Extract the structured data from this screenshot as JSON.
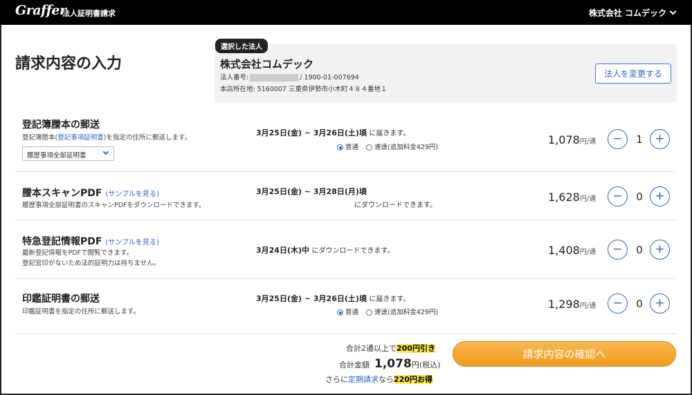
{
  "header": {
    "logo": "Graffer",
    "service": "法人証明書請求",
    "account": "株式会社 コムデック"
  },
  "page_title": "請求内容の入力",
  "selected_corp": {
    "tag": "選択した法人",
    "name": "株式会社コムデック",
    "number_label": "法人番号:",
    "number_suffix": "/ 1900-01-007694",
    "address": "本店所在地: 5160007 三重県伊勢市小木町４８４番地１",
    "change_button": "法人を変更する"
  },
  "items": [
    {
      "title": "登記簿謄本の郵送",
      "desc_prefix": "登記簿謄本(",
      "desc_link": "登記事項証明書",
      "desc_suffix": ")を指定の住所に郵送します。",
      "select_value": "履歴事項全部証明書",
      "delivery_bold": "3月25日(金) ~ 3月26日(土)頃",
      "delivery_rest": "に届きます。",
      "radio_normal": "普通",
      "radio_express": "速達(追加料金429円)",
      "price": "1,078",
      "unit": "円/通",
      "qty": "1"
    },
    {
      "title": "謄本スキャンPDF",
      "sample": "(サンプルを見る)",
      "desc": "履歴事項全部証明書のスキャンPDFをダウンロードできます。",
      "delivery_bold": "3月25日(金) ~ 3月28日(月)頃",
      "delivery_rest": "にダウンロードできます。",
      "price": "1,628",
      "unit": "円/通",
      "qty": "0"
    },
    {
      "title": "特急登記情報PDF",
      "sample": "(サンプルを見る)",
      "desc1": "最新登記情報をPDFで閲覧できます。",
      "desc2": "登記官印がないため法的証明力は持ちません。",
      "delivery_bold": "3月24日(木)中",
      "delivery_rest": "にダウンロードできます。",
      "price": "1,408",
      "unit": "円/通",
      "qty": "0"
    },
    {
      "title": "印鑑証明書の郵送",
      "desc": "印鑑証明書を指定の住所に郵送します。",
      "delivery_bold": "3月25日(金) ~ 3月26日(土)頃",
      "delivery_rest": "に届きます。",
      "radio_normal": "普通",
      "radio_express": "速達(追加料金429円)",
      "price": "1,298",
      "unit": "円/通",
      "qty": "0"
    }
  ],
  "summary": {
    "discount_prefix": "合計2通以上で",
    "discount_hl": "200円引き",
    "total_label": "合計金額",
    "total_value": "1,078",
    "total_unit": "円(税込)",
    "regular_prefix": "さらに",
    "regular_link": "定期請求",
    "regular_mid": "なら",
    "regular_hl": "220円お得",
    "confirm_button": "請求内容の確認へ"
  },
  "icons": {
    "minus": "−",
    "plus": "+"
  }
}
